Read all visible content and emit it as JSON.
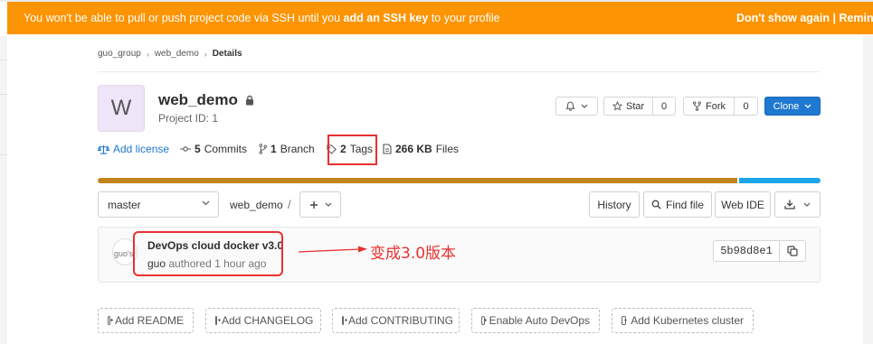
{
  "banner": {
    "message_pre": "You won't be able to pull or push project code via SSH until you ",
    "message_link": "add an SSH key",
    "message_post": " to your profile",
    "dont_show": "Don't show again",
    "divider": " | ",
    "remind": "Remind"
  },
  "breadcrumb": {
    "group": "guo_group",
    "project": "web_demo",
    "current": "Details"
  },
  "project": {
    "avatar_letter": "W",
    "name": "web_demo",
    "id_text": "Project ID: 1"
  },
  "actions": {
    "star_label": "Star",
    "star_count": "0",
    "fork_label": "Fork",
    "fork_count": "0",
    "clone_label": "Clone"
  },
  "stats": {
    "license_label": "Add license",
    "commits_count": "5",
    "commits_label": "Commits",
    "branch_count": "1",
    "branch_label": "Branch",
    "tags_count": "2",
    "tags_label": "Tags",
    "files_size": "266 KB",
    "files_label": "Files"
  },
  "languages": [
    {
      "color": "#c2851d",
      "fraction": 0.885
    },
    {
      "color": "#1aa6e8",
      "fraction": 0.115
    }
  ],
  "repo": {
    "branch": "master",
    "path": "web_demo",
    "path_sep": "/",
    "history_label": "History",
    "find_file_label": "Find file",
    "web_ide_label": "Web IDE"
  },
  "commit": {
    "avatar_alt": "guo's",
    "title": "DevOps cloud docker v3.0",
    "author": "guo",
    "authored_text": "authored 1 hour ago",
    "sha": "5b98d8e1"
  },
  "annotation": "变成3.0版本",
  "quick_actions": [
    "Add README",
    "Add CHANGELOG",
    "Add CONTRIBUTING",
    "Enable Auto DevOps",
    "Add Kubernetes cluster"
  ],
  "colors": {
    "banner_bg": "#fc9403",
    "clone_bg": "#1f78d1",
    "annotation_red": "#e8312f",
    "link_blue": "#1f78d1"
  },
  "icons": [
    "lock-icon",
    "bell-icon",
    "star-icon",
    "fork-icon",
    "scale-icon",
    "commit-icon",
    "branch-icon",
    "tag-icon",
    "file-icon",
    "search-icon",
    "download-icon",
    "copy-icon",
    "plus-icon",
    "chevron-down-icon"
  ]
}
